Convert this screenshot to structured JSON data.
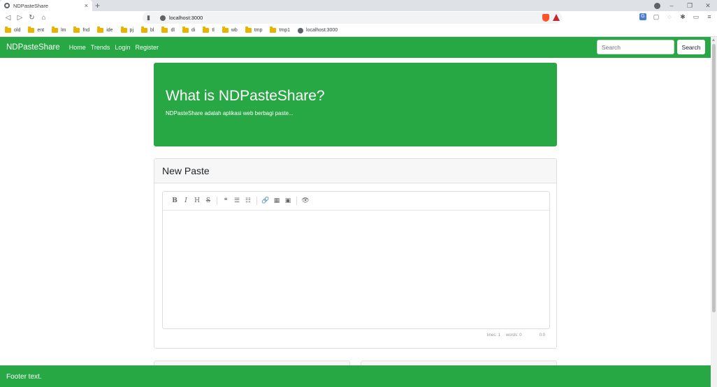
{
  "browser": {
    "tab_title": "NDPasteShare",
    "tab_close": "×",
    "new_tab": "+",
    "url": "localhost:3000",
    "bookmarks": [
      "old",
      "ent",
      "lm",
      "fnd",
      "ide",
      "pj",
      "bl",
      "dl",
      "di",
      "tl",
      "wb",
      "tmp",
      "tmp1"
    ],
    "bookmark_site": "localhost:3000"
  },
  "navbar": {
    "brand": "NDPasteShare",
    "links": [
      "Home",
      "Trends",
      "Login",
      "Register"
    ],
    "search_placeholder": "Search",
    "search_button": "Search"
  },
  "jumbotron": {
    "title": "What is NDPasteShare?",
    "text": "NDPasteShare adalah aplikasi web berbagi paste..."
  },
  "new_paste": {
    "header": "New Paste",
    "toolbar": {
      "bold": "B",
      "italic": "I",
      "heading": "H",
      "strike": "S",
      "quote": "❝",
      "ul": "☰",
      "ol": "☷",
      "link": "🔗",
      "table": "▦",
      "image": "▣",
      "preview": "👁"
    },
    "status": {
      "lines": "lines: 1",
      "words": "words: 0",
      "cursor": "0:0"
    }
  },
  "footer": {
    "text": "Footer text."
  },
  "colors": {
    "primary_green": "#28a745"
  }
}
